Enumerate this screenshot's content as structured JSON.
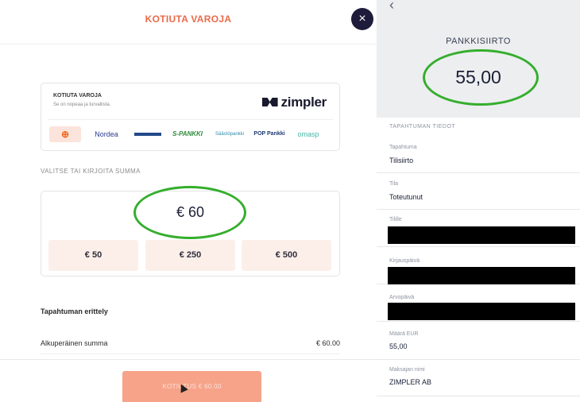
{
  "left_modal": {
    "title": "KOTIUTA VAROJA",
    "close_symbol": "×",
    "zimpler": {
      "title": "KOTIUTA VAROJA",
      "subtitle": "Se on nopeaa ja turvallista.",
      "logo_text": "zimpler",
      "banks": [
        "⊕",
        "Nordea",
        "Danske Bank",
        "S-PANKKI",
        "Säästöpankki",
        "POP Pankki",
        "omasp"
      ]
    },
    "amount_section_label": "VALITSE TAI KIRJOITA SUMMA",
    "amount_input_value": "€ 60",
    "presets": [
      "€ 50",
      "€ 250",
      "€ 500"
    ],
    "breakdown": {
      "title": "Tapahtuman erittely",
      "original_sum_label": "Alkuperäinen summa",
      "original_sum_value": "€ 60.00"
    },
    "cta_label": "KOTIUTUS € 60.00"
  },
  "right_panel": {
    "back_symbol": "‹",
    "title": "PANKKISIIRTO",
    "amount": "55,00",
    "section_title": "TAPAHTUMAN TIEDOT",
    "fields": [
      {
        "label": "Tapahtuma",
        "value": "Tilisiirto",
        "redacted": false
      },
      {
        "label": "Tila",
        "value": "Toteutunut",
        "redacted": false
      },
      {
        "label": "Tilille",
        "value": "",
        "redacted": true
      },
      {
        "label": "Kirjauspäivä",
        "value": "",
        "redacted": true
      },
      {
        "label": "Arvopäivä",
        "value": "",
        "redacted": true
      },
      {
        "label": "Määrä EUR",
        "value": "55,00",
        "redacted": false
      },
      {
        "label": "Maksajan nimi",
        "value": "ZIMPLER AB",
        "redacted": false
      }
    ]
  },
  "colors": {
    "accent_orange": "#ea6a49",
    "cta_background": "#f6a389",
    "preset_background": "#fcefea",
    "annotation_green": "#35ae2d",
    "close_button": "#1d1c3a"
  }
}
